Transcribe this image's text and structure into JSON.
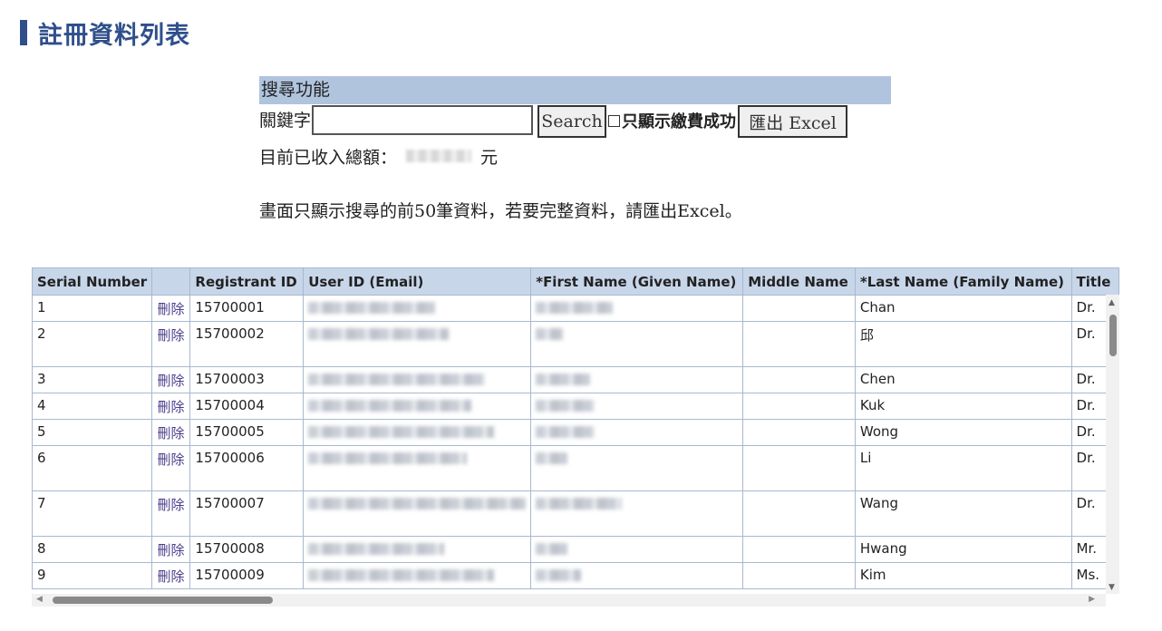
{
  "page": {
    "title": "註冊資料列表"
  },
  "search": {
    "header": "搜尋功能",
    "keyword_label": "關鍵字",
    "keyword_value": "",
    "search_button": "Search",
    "paid_only_label": "只顯示繳費成功",
    "export_button": "匯出 Excel",
    "total_prefix": "目前已收入總額：",
    "total_suffix": "元"
  },
  "notice": "畫面只顯示搜尋的前50筆資料，若要完整資料，請匯出Excel。",
  "table": {
    "headers": [
      "Serial Number",
      "",
      "Registrant ID",
      "User ID (Email)",
      "*First Name (Given Name)",
      "Middle Name",
      "*Last Name (Family Name)",
      "Title"
    ],
    "delete_label": "刪除",
    "rows": [
      {
        "serial": "1",
        "reg_id": "15700001",
        "last_name": "Chan",
        "title": "Dr."
      },
      {
        "serial": "2",
        "reg_id": "15700002",
        "last_name": "邱",
        "title": "Dr."
      },
      {
        "serial": "3",
        "reg_id": "15700003",
        "last_name": "Chen",
        "title": "Dr."
      },
      {
        "serial": "4",
        "reg_id": "15700004",
        "last_name": "Kuk",
        "title": "Dr."
      },
      {
        "serial": "5",
        "reg_id": "15700005",
        "last_name": "Wong",
        "title": "Dr."
      },
      {
        "serial": "6",
        "reg_id": "15700006",
        "last_name": "Li",
        "title": "Dr."
      },
      {
        "serial": "7",
        "reg_id": "15700007",
        "last_name": "Wang",
        "title": "Dr."
      },
      {
        "serial": "8",
        "reg_id": "15700008",
        "last_name": "Hwang",
        "title": "Mr."
      },
      {
        "serial": "9",
        "reg_id": "15700009",
        "last_name": "Kim",
        "title": "Ms."
      }
    ]
  },
  "colors": {
    "accent": "#2f4f8c",
    "header_bg": "#c8d6ea",
    "search_header_bg": "#b0c4de",
    "delete_link": "#4a3f8c"
  }
}
